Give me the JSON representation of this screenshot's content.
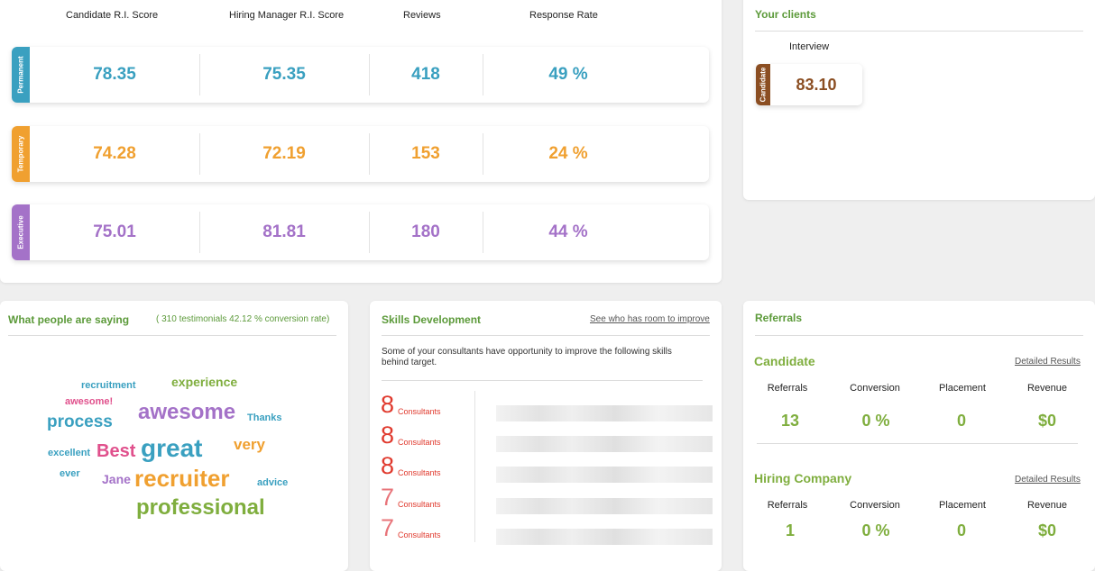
{
  "scores": {
    "columns": [
      "Candidate R.I. Score",
      "Hiring Manager R.I. Score",
      "Reviews",
      "Response Rate"
    ],
    "rows": [
      {
        "label": "Permanent",
        "color": "#3aa0c0",
        "candidate": "78.35",
        "hiring": "75.35",
        "reviews": "418",
        "response": "49 %"
      },
      {
        "label": "Temporary",
        "color": "#f0a030",
        "candidate": "74.28",
        "hiring": "72.19",
        "reviews": "153",
        "response": "24 %"
      },
      {
        "label": "Executive",
        "color": "#a472c8",
        "candidate": "75.01",
        "hiring": "81.81",
        "reviews": "180",
        "response": "44 %"
      }
    ]
  },
  "clients": {
    "title": "Your clients",
    "interview_label": "Interview",
    "candidate_tag": "Candidate",
    "candidate_value": "83.10",
    "color": "#8b4e22"
  },
  "testimonials": {
    "title": "What people are saying",
    "summary": "( 310 testimonials 42.12 % conversion rate)",
    "words": [
      "recruitment",
      "experience",
      "awesome!",
      "awesome",
      "process",
      "Thanks",
      "excellent",
      "Best",
      "great",
      "very",
      "ever",
      "Jane",
      "recruiter",
      "advice",
      "professional"
    ]
  },
  "skills": {
    "title": "Skills Development",
    "link": "See who has room to improve",
    "description": "Some of your consultants have opportunity to improve the following skills behind target.",
    "unit": "Consultants",
    "items": [
      "8",
      "8",
      "8",
      "7",
      "7"
    ]
  },
  "referrals": {
    "title": "Referrals",
    "headers": [
      "Referrals",
      "Conversion",
      "Placement",
      "Revenue"
    ],
    "sections": [
      {
        "name": "Candidate",
        "link": "Detailed Results",
        "values": [
          "13",
          "0 %",
          "0",
          "$0"
        ]
      },
      {
        "name": "Hiring Company",
        "link": "Detailed Results",
        "values": [
          "1",
          "0 %",
          "0",
          "$0"
        ]
      }
    ]
  }
}
